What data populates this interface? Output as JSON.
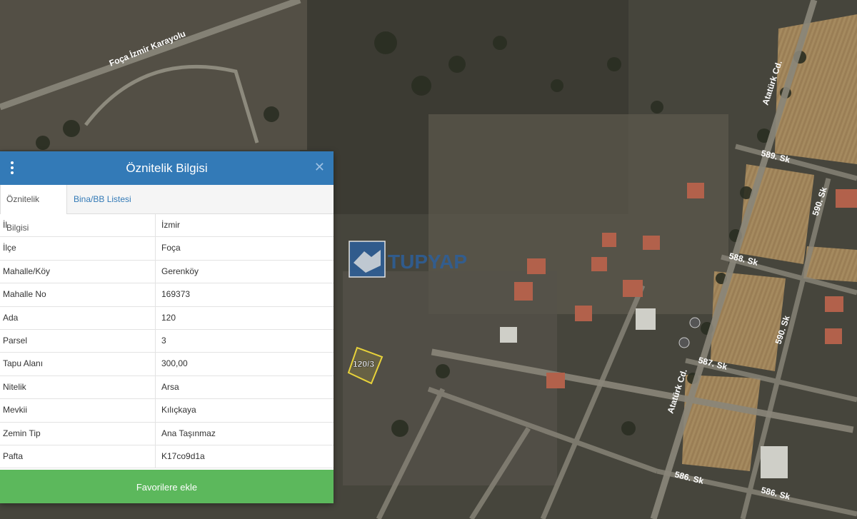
{
  "panel": {
    "title": "Öznitelik Bilgisi",
    "tabs": [
      "Öznitelik Bilgisi",
      "Bina/BB Listesi"
    ],
    "rows": [
      {
        "key": "İl",
        "value": "İzmir"
      },
      {
        "key": "İlçe",
        "value": "Foça"
      },
      {
        "key": "Mahalle/Köy",
        "value": "Gerenköy"
      },
      {
        "key": "Mahalle No",
        "value": "169373"
      },
      {
        "key": "Ada",
        "value": "120"
      },
      {
        "key": "Parsel",
        "value": "3"
      },
      {
        "key": "Tapu Alanı",
        "value": "300,00"
      },
      {
        "key": "Nitelik",
        "value": "Arsa"
      },
      {
        "key": "Mevkii",
        "value": "Kılıçkaya"
      },
      {
        "key": "Zemin Tip",
        "value": "Ana Taşınmaz"
      },
      {
        "key": "Pafta",
        "value": "K17co9d1a"
      }
    ],
    "favorite_button": "Favorilere ekle"
  },
  "map": {
    "road_labels": [
      "Foça İzmir Karayolu",
      "Atatürk Cd.",
      "Atatürk Cd.",
      "589. Sk",
      "590. Sk",
      "588. Sk",
      "590. Sk",
      "587. Sk",
      "586. Sk",
      "586. Sk"
    ],
    "parcel_label": "120/3",
    "watermark": "TUPYAP"
  },
  "colors": {
    "header": "#337ab7",
    "favorite": "#5cb85c",
    "parcel_outline": "#e8d23a"
  }
}
